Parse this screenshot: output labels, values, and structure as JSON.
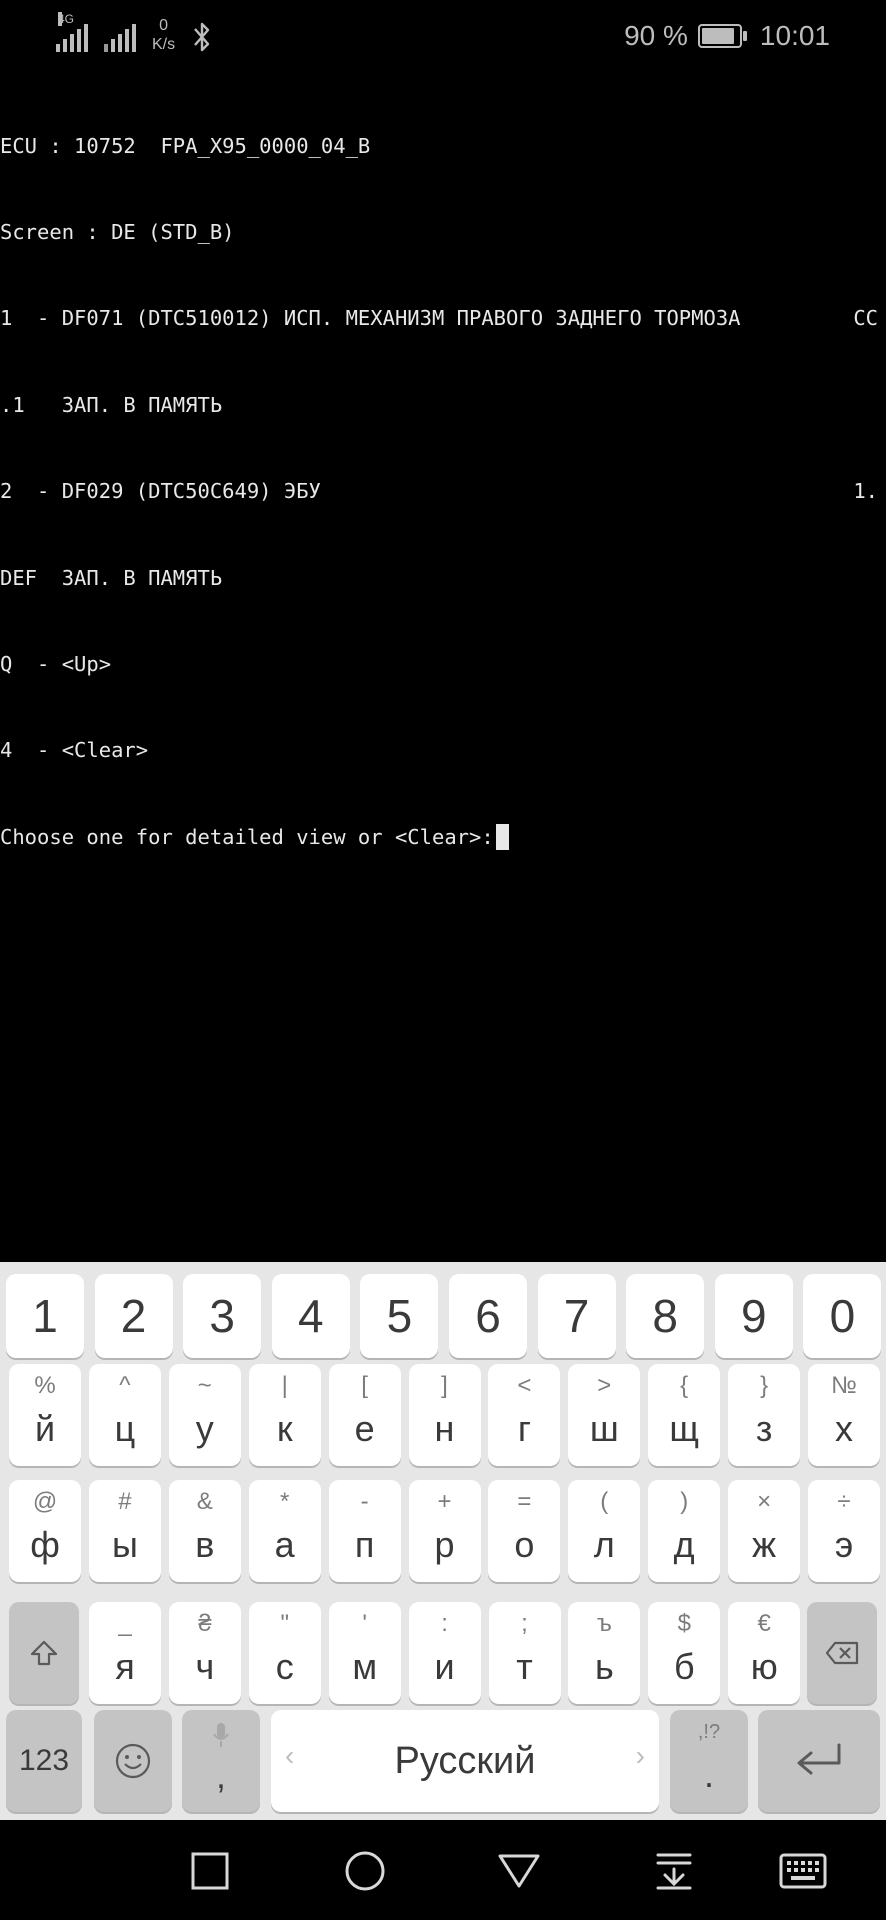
{
  "status_bar": {
    "network_tag": "4G",
    "speed_value": "0",
    "speed_unit": "K/s",
    "battery_percent": "90 %",
    "battery_level": 0.9,
    "time": "10:01"
  },
  "terminal": {
    "lines": [
      {
        "text": "ECU : 10752  FPA_X95_0000_04_B",
        "right": ""
      },
      {
        "text": "Screen : DE (STD_B)",
        "right": ""
      },
      {
        "text": "1  - DF071 (DTC510012) ИСП. МЕХАНИЗМ ПРАВОГО ЗАДНЕГО ТОРМОЗА",
        "right": "CC"
      },
      {
        "text": ".1   ЗАП. В ПАМЯТЬ",
        "right": ""
      },
      {
        "text": "2  - DF029 (DTC50C649) ЭБУ",
        "right": "1."
      },
      {
        "text": "DEF  ЗАП. В ПАМЯТЬ",
        "right": ""
      },
      {
        "text": "Q  - <Up>",
        "right": ""
      },
      {
        "text": "4  - <Clear>",
        "right": ""
      },
      {
        "text": "Choose one for detailed view or <Clear>:",
        "right": ""
      }
    ]
  },
  "keyboard": {
    "number_row": [
      "1",
      "2",
      "3",
      "4",
      "5",
      "6",
      "7",
      "8",
      "9",
      "0"
    ],
    "row1": [
      {
        "sec": "%",
        "pri": "й"
      },
      {
        "sec": "^",
        "pri": "ц"
      },
      {
        "sec": "~",
        "pri": "у"
      },
      {
        "sec": "|",
        "pri": "к"
      },
      {
        "sec": "[",
        "pri": "е"
      },
      {
        "sec": "]",
        "pri": "н"
      },
      {
        "sec": "<",
        "pri": "г"
      },
      {
        "sec": ">",
        "pri": "ш"
      },
      {
        "sec": "{",
        "pri": "щ"
      },
      {
        "sec": "}",
        "pri": "з"
      },
      {
        "sec": "№",
        "pri": "х"
      }
    ],
    "row2": [
      {
        "sec": "@",
        "pri": "ф"
      },
      {
        "sec": "#",
        "pri": "ы"
      },
      {
        "sec": "&",
        "pri": "в"
      },
      {
        "sec": "*",
        "pri": "а"
      },
      {
        "sec": "-",
        "pri": "п"
      },
      {
        "sec": "+",
        "pri": "р"
      },
      {
        "sec": "=",
        "pri": "о"
      },
      {
        "sec": "(",
        "pri": "л"
      },
      {
        "sec": ")",
        "pri": "д"
      },
      {
        "sec": "×",
        "pri": "ж"
      },
      {
        "sec": "÷",
        "pri": "э"
      }
    ],
    "row3": [
      {
        "sec": "_",
        "pri": "я"
      },
      {
        "sec": "₴",
        "pri": "ч"
      },
      {
        "sec": "\"",
        "pri": "с"
      },
      {
        "sec": "'",
        "pri": "м"
      },
      {
        "sec": ":",
        "pri": "и"
      },
      {
        "sec": ";",
        "pri": "т"
      },
      {
        "sec": "ъ",
        "pri": "ь"
      },
      {
        "sec": "$",
        "pri": "б"
      },
      {
        "sec": "€",
        "pri": "ю"
      }
    ],
    "bottom": {
      "symbols_label": "123",
      "comma": ",",
      "space_label": "Русский",
      "period_sec": ",!?",
      "period": "."
    }
  },
  "icons": {
    "shift": "shift-icon",
    "backspace": "backspace-icon",
    "emoji": "emoji-icon",
    "mic": "mic-icon",
    "enter": "enter-icon",
    "nav_recents": "square-icon",
    "nav_home": "circle-icon",
    "nav_back": "triangle-icon",
    "nav_hide_keyboard": "hide-keyboard-icon",
    "nav_keyboard": "keyboard-icon"
  }
}
